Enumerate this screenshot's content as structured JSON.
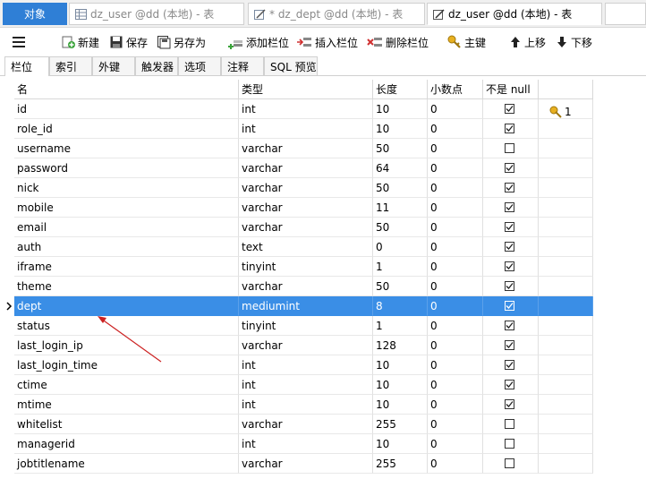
{
  "tabs": {
    "objects": "对象",
    "tab1": "dz_user @dd (本地) - 表",
    "tab2": "* dz_dept @dd (本地) - 表",
    "tab3": "dz_user @dd (本地) - 表"
  },
  "toolbar": {
    "new": "新建",
    "save": "保存",
    "save_as": "另存为",
    "add_column": "添加栏位",
    "insert_column": "插入栏位",
    "delete_column": "删除栏位",
    "primary_key": "主键",
    "move_up": "上移",
    "move_down": "下移"
  },
  "subtabs": [
    "栏位",
    "索引",
    "外键",
    "触发器",
    "选项",
    "注释",
    "SQL 预览"
  ],
  "columns": [
    "名",
    "类型",
    "长度",
    "小数点",
    "不是 null",
    ""
  ],
  "rows": [
    {
      "name": "id",
      "type": "int",
      "length": "10",
      "decimals": "0",
      "not_null": true,
      "key": "1"
    },
    {
      "name": "role_id",
      "type": "int",
      "length": "10",
      "decimals": "0",
      "not_null": true,
      "key": ""
    },
    {
      "name": "username",
      "type": "varchar",
      "length": "50",
      "decimals": "0",
      "not_null": false,
      "key": ""
    },
    {
      "name": "password",
      "type": "varchar",
      "length": "64",
      "decimals": "0",
      "not_null": true,
      "key": ""
    },
    {
      "name": "nick",
      "type": "varchar",
      "length": "50",
      "decimals": "0",
      "not_null": true,
      "key": ""
    },
    {
      "name": "mobile",
      "type": "varchar",
      "length": "11",
      "decimals": "0",
      "not_null": true,
      "key": ""
    },
    {
      "name": "email",
      "type": "varchar",
      "length": "50",
      "decimals": "0",
      "not_null": true,
      "key": ""
    },
    {
      "name": "auth",
      "type": "text",
      "length": "0",
      "decimals": "0",
      "not_null": true,
      "key": ""
    },
    {
      "name": "iframe",
      "type": "tinyint",
      "length": "1",
      "decimals": "0",
      "not_null": true,
      "key": ""
    },
    {
      "name": "theme",
      "type": "varchar",
      "length": "50",
      "decimals": "0",
      "not_null": true,
      "key": ""
    },
    {
      "name": "dept",
      "type": "mediumint",
      "length": "8",
      "decimals": "0",
      "not_null": true,
      "key": "",
      "selected": true
    },
    {
      "name": "status",
      "type": "tinyint",
      "length": "1",
      "decimals": "0",
      "not_null": true,
      "key": ""
    },
    {
      "name": "last_login_ip",
      "type": "varchar",
      "length": "128",
      "decimals": "0",
      "not_null": true,
      "key": ""
    },
    {
      "name": "last_login_time",
      "type": "int",
      "length": "10",
      "decimals": "0",
      "not_null": true,
      "key": ""
    },
    {
      "name": "ctime",
      "type": "int",
      "length": "10",
      "decimals": "0",
      "not_null": true,
      "key": ""
    },
    {
      "name": "mtime",
      "type": "int",
      "length": "10",
      "decimals": "0",
      "not_null": true,
      "key": ""
    },
    {
      "name": "whitelist",
      "type": "varchar",
      "length": "255",
      "decimals": "0",
      "not_null": false,
      "key": ""
    },
    {
      "name": "managerid",
      "type": "int",
      "length": "10",
      "decimals": "0",
      "not_null": false,
      "key": ""
    },
    {
      "name": "jobtitlename",
      "type": "varchar",
      "length": "255",
      "decimals": "0",
      "not_null": false,
      "key": ""
    }
  ],
  "colors": {
    "accent": "#2f7fd6",
    "selection": "#3a8ee6",
    "annotation": "#cc2222"
  }
}
